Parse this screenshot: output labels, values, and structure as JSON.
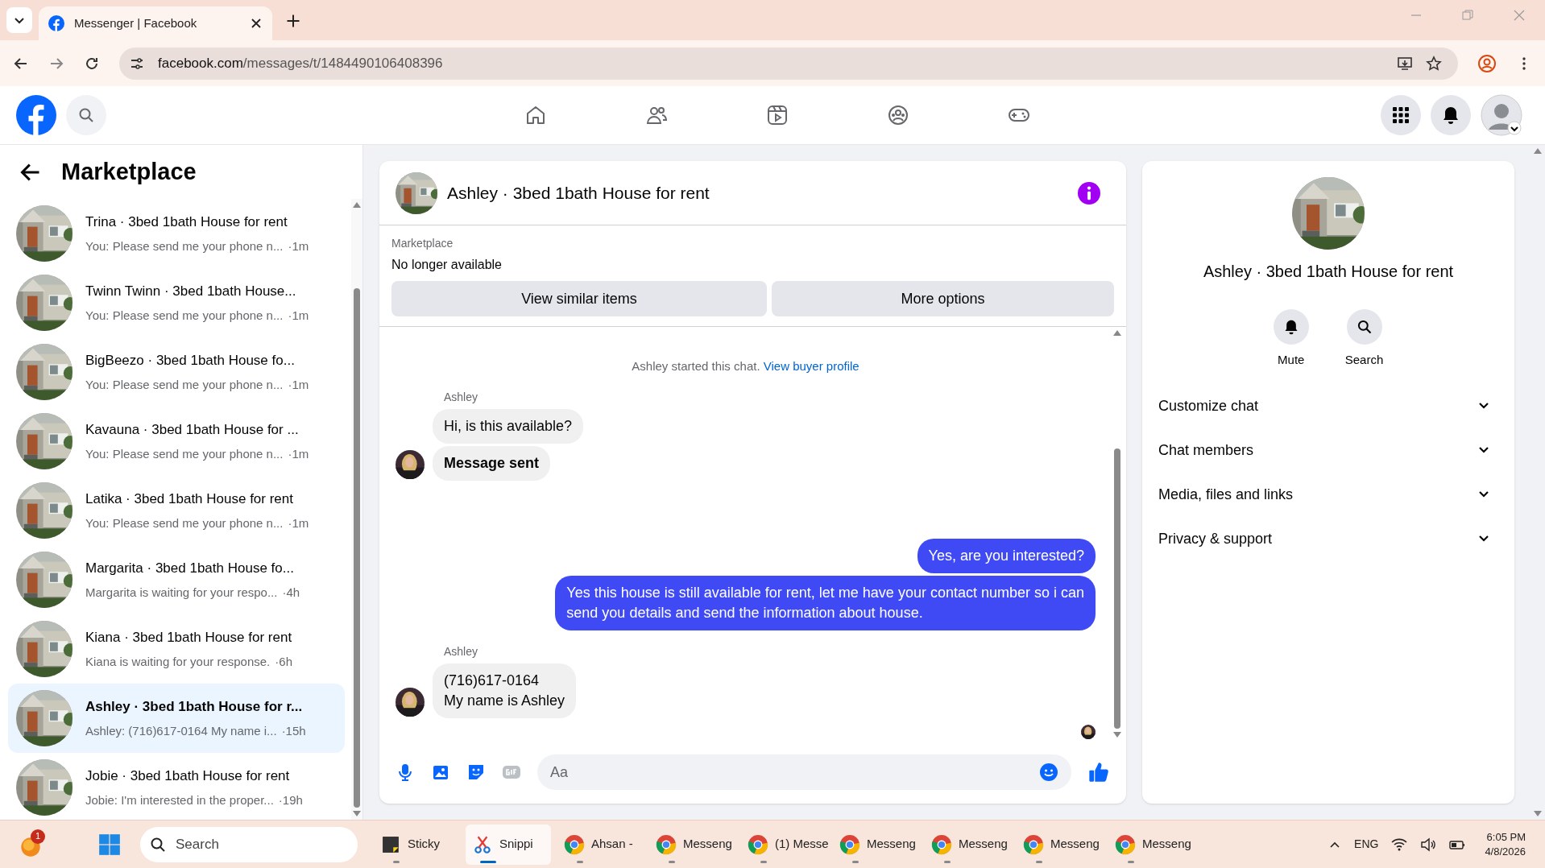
{
  "browser": {
    "tab_title": "Messenger | Facebook",
    "url_host": "facebook.com",
    "url_path": "/messages/t/1484490106408396"
  },
  "header": {
    "nav": [
      {
        "kind": "home",
        "selected": false
      },
      {
        "kind": "friends",
        "selected": false
      },
      {
        "kind": "video",
        "selected": false
      },
      {
        "kind": "groups",
        "selected": false
      },
      {
        "kind": "gaming",
        "selected": false
      }
    ]
  },
  "sidebar": {
    "title": "Marketplace",
    "conversations": [
      {
        "title": "Trina · 3bed 1bath House for rent",
        "preview": "You: Please send me your phone n...",
        "time": "·1m",
        "selected": false
      },
      {
        "title": "Twinn Twinn · 3bed 1bath House...",
        "preview": "You: Please send me your phone n...",
        "time": "·1m",
        "selected": false
      },
      {
        "title": "BigBeezo · 3bed 1bath House fo...",
        "preview": "You: Please send me your phone n...",
        "time": "·1m",
        "selected": false
      },
      {
        "title": "Kavauna · 3bed 1bath House for ...",
        "preview": "You: Please send me your phone n...",
        "time": "·1m",
        "selected": false
      },
      {
        "title": "Latika · 3bed 1bath House for rent",
        "preview": "You: Please send me your phone n...",
        "time": "·1m",
        "selected": false
      },
      {
        "title": "Margarita · 3bed 1bath House fo...",
        "preview": "Margarita is waiting for your respo...",
        "time": "·4h",
        "selected": false
      },
      {
        "title": "Kiana · 3bed 1bath House for rent",
        "preview": "Kiana is waiting for your response.",
        "time": "·6h",
        "selected": false
      },
      {
        "title": "Ashley · 3bed 1bath House for r...",
        "preview": "Ashley: (716)617-0164 My name i...",
        "time": "·15h",
        "selected": true
      },
      {
        "title": "Jobie · 3bed 1bath House for rent",
        "preview": "Jobie: I'm interested in the proper...",
        "time": "·19h",
        "selected": false
      }
    ]
  },
  "chat": {
    "title": "Ashley · 3bed 1bath House for rent",
    "listing": {
      "label": "Marketplace",
      "status": "No longer available",
      "buttons": [
        "View similar items",
        "More options"
      ]
    },
    "note": {
      "text": "Ashley started this chat.",
      "link": "View buyer profile"
    },
    "groups": [
      {
        "kind": "incoming",
        "sender": "Ashley",
        "messages": [
          {
            "lines": [
              "Hi, is this available?"
            ],
            "bold": false
          },
          {
            "lines": [
              "Message sent"
            ],
            "bold": true
          }
        ]
      },
      {
        "kind": "outgoing",
        "messages": [
          {
            "lines": [
              "Yes, are you interested?"
            ],
            "bold": false
          },
          {
            "lines": [
              "Yes this house is still available for rent, let me have your contact number so i can",
              "send you details and send the information about house."
            ],
            "bold": false
          }
        ]
      },
      {
        "kind": "incoming",
        "sender": "Ashley",
        "messages": [
          {
            "lines": [
              "(716)617-0164",
              "My name is Ashley"
            ],
            "bold": false
          }
        ]
      }
    ],
    "composer": {
      "placeholder": "Aa"
    }
  },
  "details": {
    "title": "Ashley · 3bed 1bath House for rent",
    "actions": [
      {
        "kind": "bell",
        "label": "Mute"
      },
      {
        "kind": "search",
        "label": "Search"
      }
    ],
    "sections": [
      {
        "label": "Customize chat",
        "expanded": false
      },
      {
        "label": "Chat members",
        "expanded": false
      },
      {
        "label": "Media, files and links",
        "expanded": false
      },
      {
        "label": "Privacy & support",
        "expanded": false
      }
    ]
  },
  "taskbar": {
    "badge": "1",
    "search": "Search",
    "apps": [
      {
        "kind": "sticky",
        "label": "Sticky",
        "active": false
      },
      {
        "kind": "snip",
        "label": "Snippi",
        "active": true
      },
      {
        "kind": "chrome",
        "label": "Ahsan -",
        "active": false
      },
      {
        "kind": "chrome",
        "label": "Messeng",
        "active": false
      },
      {
        "kind": "chrome",
        "label": "(1) Messe",
        "active": false
      },
      {
        "kind": "chrome",
        "label": "Messeng",
        "active": false
      },
      {
        "kind": "chrome",
        "label": "Messeng",
        "active": false
      },
      {
        "kind": "chrome",
        "label": "Messeng",
        "active": false
      },
      {
        "kind": "chrome",
        "label": "Messeng",
        "active": false
      }
    ],
    "language": "ENG",
    "time": "6:05 PM",
    "date": "4/8/2026"
  }
}
